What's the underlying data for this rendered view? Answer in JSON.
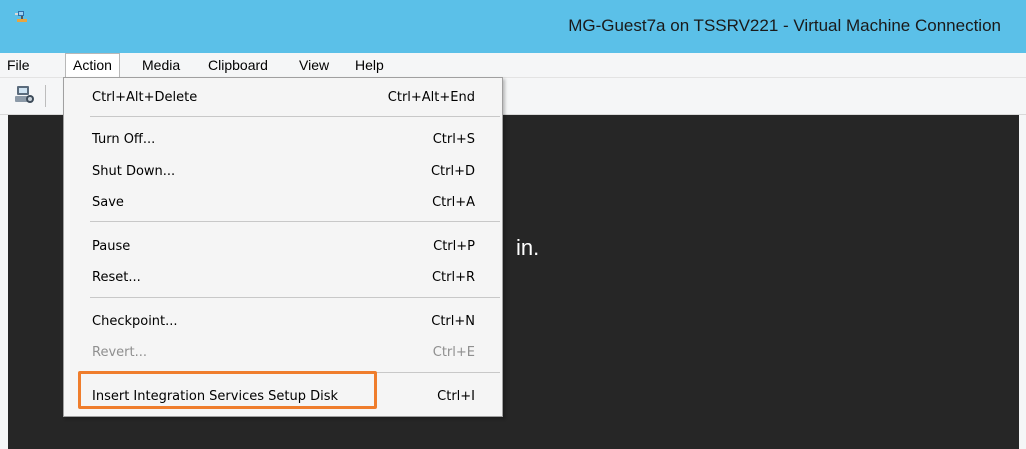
{
  "window": {
    "title": "MG-Guest7a on TSSRV221 - Virtual Machine Connection"
  },
  "menubar": [
    "File",
    "Action",
    "Media",
    "Clipboard",
    "View",
    "Help"
  ],
  "toolbar": {
    "icons": [
      "ctrl-alt-del-icon"
    ]
  },
  "screen": {
    "text": "in."
  },
  "action_menu": {
    "items": [
      {
        "label": "Ctrl+Alt+Delete",
        "shortcut": "Ctrl+Alt+End",
        "enabled": true
      },
      {
        "label": "Turn Off...",
        "shortcut": "Ctrl+S",
        "enabled": true
      },
      {
        "label": "Shut Down...",
        "shortcut": "Ctrl+D",
        "enabled": true
      },
      {
        "label": "Save",
        "shortcut": "Ctrl+A",
        "enabled": true
      },
      {
        "label": "Pause",
        "shortcut": "Ctrl+P",
        "enabled": true
      },
      {
        "label": "Reset...",
        "shortcut": "Ctrl+R",
        "enabled": true
      },
      {
        "label": "Checkpoint...",
        "shortcut": "Ctrl+N",
        "enabled": true
      },
      {
        "label": "Revert...",
        "shortcut": "Ctrl+E",
        "enabled": false
      },
      {
        "label": "Insert Integration Services Setup Disk",
        "shortcut": "Ctrl+I",
        "enabled": true
      }
    ]
  },
  "colors": {
    "titlebar": "#5bc0e8",
    "highlight": "#ef7d2c",
    "screen": "#262626",
    "disabled_text": "#8f8f8f"
  }
}
